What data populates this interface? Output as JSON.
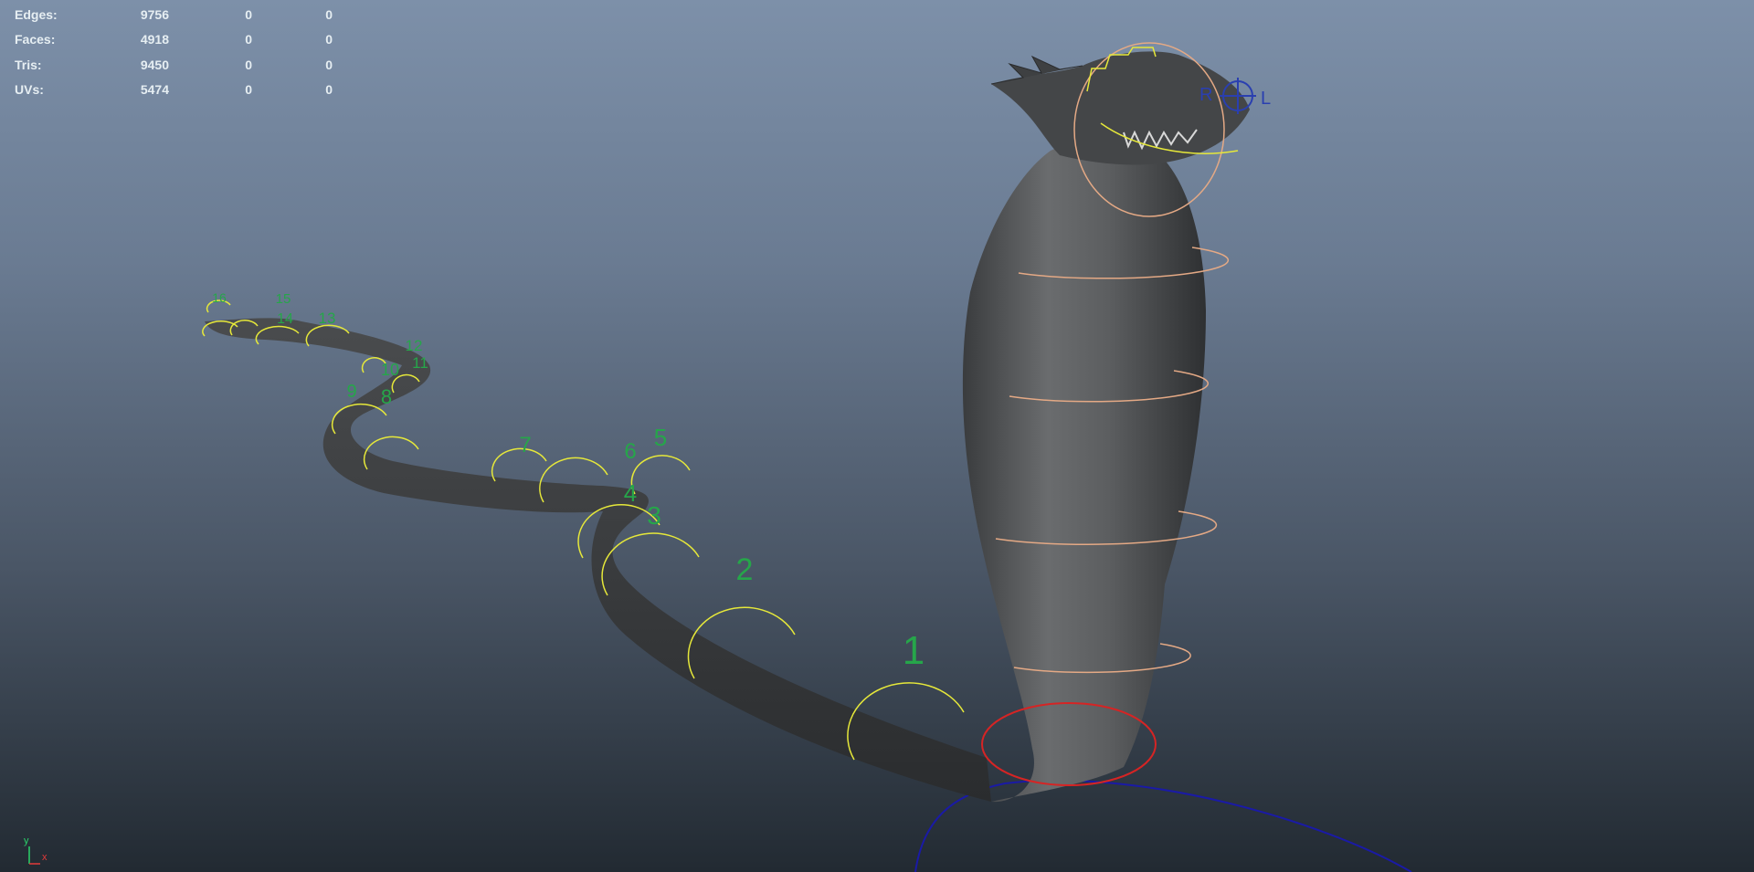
{
  "stats": [
    {
      "label": "Edges:",
      "v1": "9756",
      "v2": "0",
      "v3": "0"
    },
    {
      "label": "Faces:",
      "v1": "4918",
      "v2": "0",
      "v3": "0"
    },
    {
      "label": "Tris:",
      "v1": "9450",
      "v2": "0",
      "v3": "0"
    },
    {
      "label": "UVs:",
      "v1": "5474",
      "v2": "0",
      "v3": "0"
    }
  ],
  "controls": [
    "1",
    "2",
    "3",
    "4",
    "5",
    "6",
    "7",
    "8",
    "9",
    "10",
    "11",
    "12",
    "13",
    "14",
    "15",
    "16"
  ],
  "eye_labels": {
    "left": "R",
    "right": "L"
  },
  "axis": {
    "y": "y",
    "x": "x"
  },
  "colors": {
    "control_curve": "#e6e83a",
    "control_label": "#26a64a",
    "spine_ring": "#e4a985",
    "root_ring": "#d62424",
    "world_ring": "#1a1aa6",
    "eye_control": "#2a3fb0",
    "mesh": "#555758"
  }
}
